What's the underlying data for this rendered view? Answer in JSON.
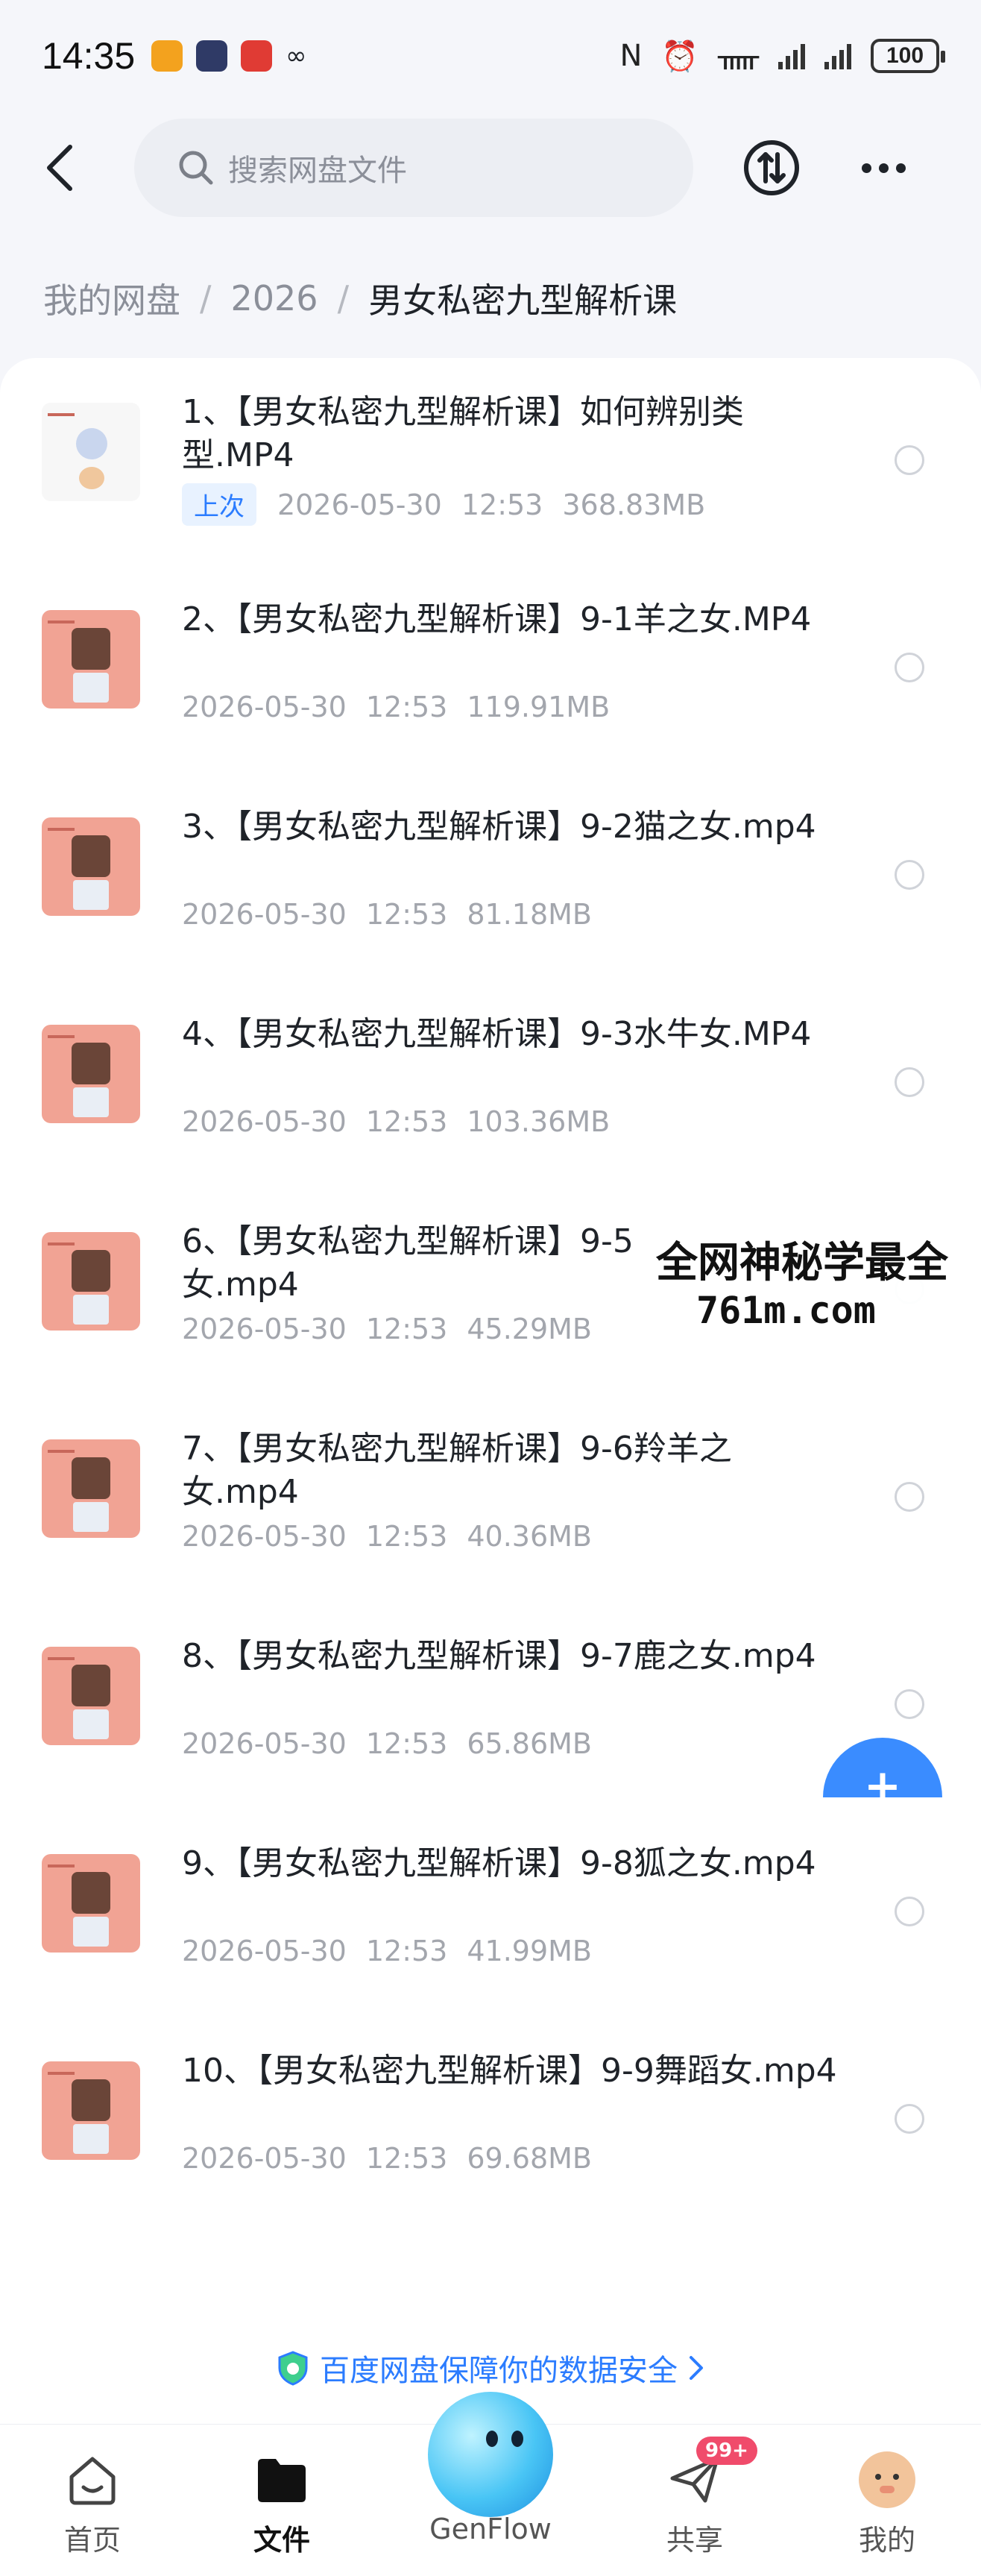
{
  "status_bar": {
    "time": "14:35",
    "battery": "100",
    "icons": [
      "nfc-icon",
      "alarm-icon",
      "bluetooth-icon",
      "signal-icon",
      "signal-icon"
    ]
  },
  "header": {
    "search_placeholder": "搜索网盘文件"
  },
  "breadcrumb": {
    "items": [
      "我的网盘",
      "2026",
      "男女私密九型解析课"
    ]
  },
  "files": [
    {
      "name": "1、【男女私密九型解析课】如何辨别类型.MP4",
      "badge": "上次",
      "date": "2026-05-30",
      "time": "12:53",
      "size": "368.83MB"
    },
    {
      "name": "2、【男女私密九型解析课】9-1羊之女.MP4",
      "date": "2026-05-30",
      "time": "12:53",
      "size": "119.91MB"
    },
    {
      "name": "3、【男女私密九型解析课】9-2猫之女.mp4",
      "date": "2026-05-30",
      "time": "12:53",
      "size": "81.18MB"
    },
    {
      "name": "4、【男女私密九型解析课】9-3水牛女.MP4",
      "date": "2026-05-30",
      "time": "12:53",
      "size": "103.36MB"
    },
    {
      "name": "6、【男女私密九型解析课】9-5",
      "name_line2": "女.mp4",
      "date": "2026-05-30",
      "time": "12:53",
      "size": "45.29MB"
    },
    {
      "name": "7、【男女私密九型解析课】9-6羚羊之女.mp4",
      "date": "2026-05-30",
      "time": "12:53",
      "size": "40.36MB"
    },
    {
      "name": "8、【男女私密九型解析课】9-7鹿之女.mp4",
      "date": "2026-05-30",
      "time": "12:53",
      "size": "65.86MB"
    },
    {
      "name": "9、【男女私密九型解析课】9-8狐之女.mp4",
      "date": "2026-05-30",
      "time": "12:53",
      "size": "41.99MB"
    },
    {
      "name": "10、【男女私密九型解析课】9-9舞蹈女.mp4",
      "date": "2026-05-30",
      "time": "12:53",
      "size": "69.68MB"
    }
  ],
  "watermark": {
    "line1": "全网神秘学最全",
    "line2": "761m.com"
  },
  "security_note": "百度网盘保障你的数据安全",
  "nav": {
    "home": "首页",
    "files": "文件",
    "genflow": "GenFlow",
    "share": "共享",
    "share_badge": "99+",
    "me": "我的"
  },
  "colors": {
    "accent": "#2b7cff",
    "badge": "#f04b6b"
  }
}
